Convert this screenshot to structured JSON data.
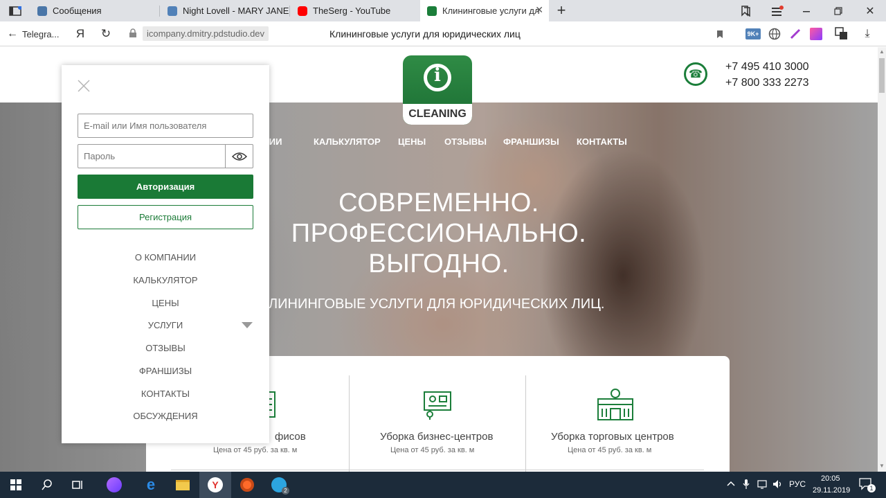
{
  "browser": {
    "tabs": [
      {
        "label": "Сообщения",
        "favicon_color": "#4a76a8"
      },
      {
        "label": "Night Lovell - MARY JANE",
        "favicon_color": "#5181b8"
      },
      {
        "label": "TheSerg - YouTube",
        "favicon_color": "#ff0000"
      },
      {
        "label": "Клининговые услуги дл",
        "favicon_color": "#1b7e3a"
      }
    ],
    "back_label": "Telegra...",
    "yandex_glyph": "Я",
    "url_host": "icompany.dmitry.pdstudio.dev",
    "page_title": "Клининговые услуги для юридических лиц",
    "extension_badge": "9K+"
  },
  "site": {
    "logo_letter": "i",
    "logo_text": "CLEANING",
    "phones": [
      "+7 495 410 3000",
      "+7 800 333 2273"
    ],
    "top_nav": [
      "АНИИ",
      "КАЛЬКУЛЯТОР",
      "ЦЕНЫ",
      "ОТЗЫВЫ",
      "ФРАНШИЗЫ",
      "КОНТАКТЫ"
    ],
    "hero_lines": [
      "СОВРЕМЕННО.",
      "ПРОФЕССИОНАЛЬНО.",
      "ВЫГОДНО."
    ],
    "hero_subtitle": "ЛИНИНГОВЫЕ УСЛУГИ ДЛЯ ЮРИДИЧЕСКИХ ЛИЦ.",
    "cards": [
      {
        "title": "фисов",
        "price": "Цена от 45 руб. за кв. м"
      },
      {
        "title": "Уборка бизнес-центров",
        "price": "Цена от 45 руб. за кв. м"
      },
      {
        "title": "Уборка торговых центров",
        "price": "Цена от 45 руб. за кв. м"
      }
    ]
  },
  "panel": {
    "email_placeholder": "E-mail или Имя пользователя",
    "password_placeholder": "Пароль",
    "login_label": "Авторизация",
    "register_label": "Регистрация",
    "menu": [
      "О КОМПАНИИ",
      "КАЛЬКУЛЯТОР",
      "ЦЕНЫ",
      "УСЛУГИ",
      "ОТЗЫВЫ",
      "ФРАНШИЗЫ",
      "КОНТАКТЫ",
      "ОБСУЖДЕНИЯ"
    ]
  },
  "taskbar": {
    "language": "РУС",
    "time": "20:05",
    "date": "29.11.2019",
    "telegram_badge": "2",
    "notification_count": "1"
  },
  "colors": {
    "brand_green": "#1a7a36",
    "taskbar_bg": "#1c2b3a"
  }
}
